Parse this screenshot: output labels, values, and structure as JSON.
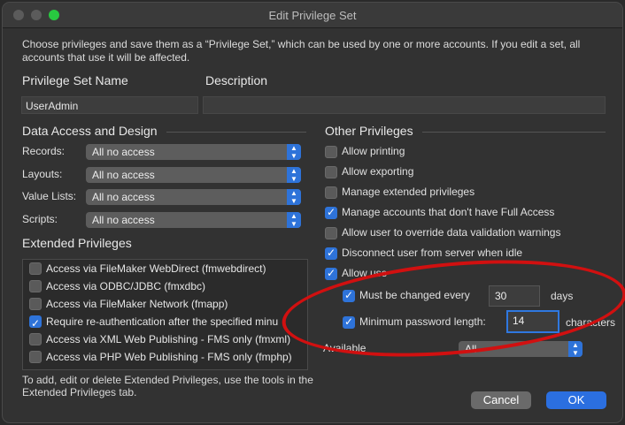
{
  "window": {
    "title": "Edit Privilege Set"
  },
  "intro": "Choose privileges and save them as a “Privilege Set,” which can be used by one or more accounts. If you edit a set, all accounts that use it will be affected.",
  "privilege_set_name": {
    "label": "Privilege Set Name",
    "value": "UserAdmin"
  },
  "description": {
    "label": "Description",
    "value": ""
  },
  "data_access": {
    "heading": "Data Access and Design",
    "rows": [
      {
        "label": "Records:",
        "value": "All no access"
      },
      {
        "label": "Layouts:",
        "value": "All no access"
      },
      {
        "label": "Value Lists:",
        "value": "All no access"
      },
      {
        "label": "Scripts:",
        "value": "All no access"
      }
    ]
  },
  "extended": {
    "heading": "Extended Privileges",
    "items": [
      {
        "label": "Access via FileMaker WebDirect (fmwebdirect)",
        "checked": false
      },
      {
        "label": "Access via ODBC/JDBC (fmxdbc)",
        "checked": false
      },
      {
        "label": "Access via FileMaker Network (fmapp)",
        "checked": false
      },
      {
        "label": "Require re-authentication after the specified minu",
        "checked": true
      },
      {
        "label": "Access via XML Web Publishing - FMS only (fmxml)",
        "checked": false
      },
      {
        "label": "Access via PHP Web Publishing - FMS only (fmphp)",
        "checked": false
      }
    ],
    "footer": "To add, edit or delete Extended Privileges, use the tools in the Extended Privileges tab."
  },
  "other": {
    "heading": "Other Privileges",
    "items": [
      {
        "label": "Allow printing",
        "checked": false
      },
      {
        "label": "Allow exporting",
        "checked": false
      },
      {
        "label": "Manage extended privileges",
        "checked": false
      },
      {
        "label": "Manage accounts that don't have Full Access",
        "checked": true
      },
      {
        "label": "Allow user to override data validation warnings",
        "checked": false
      },
      {
        "label": "Disconnect user from server when idle",
        "checked": true
      },
      {
        "label": "Allow use",
        "checked": true
      }
    ],
    "must_change": {
      "label": "Must be changed every",
      "value": "30",
      "unit": "days",
      "checked": true
    },
    "min_length": {
      "label": "Minimum password length:",
      "value": "14",
      "unit": "characters",
      "checked": true
    },
    "available": {
      "label": "Available",
      "value": "All"
    }
  },
  "buttons": {
    "cancel": "Cancel",
    "ok": "OK"
  },
  "colors": {
    "accent": "#2e73d9",
    "annotation": "#d11010"
  }
}
